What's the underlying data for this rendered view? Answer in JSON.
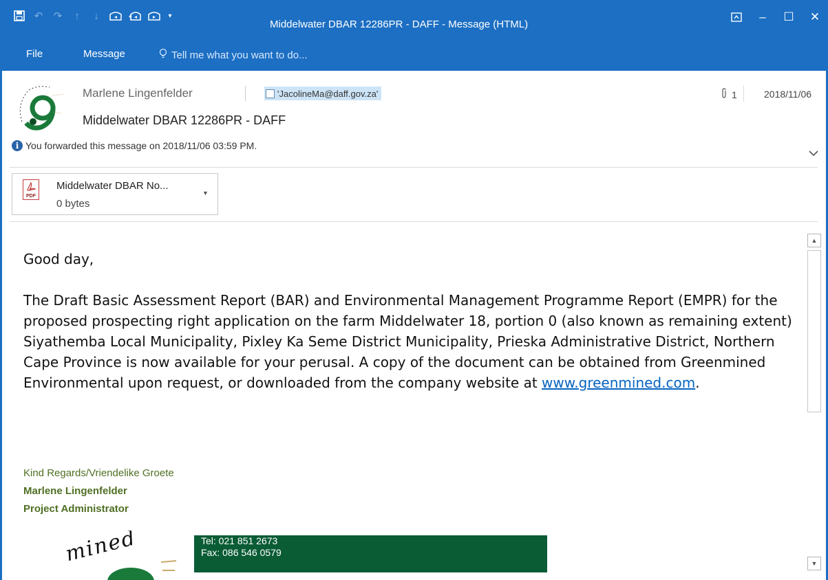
{
  "window": {
    "title": "Middelwater DBAR 12286PR - DAFF - Message (HTML)",
    "controls": [
      "ribbon-display-options",
      "minimize",
      "maximize",
      "close"
    ]
  },
  "quick_access": [
    "save-icon",
    "undo-icon",
    "redo-icon",
    "up-icon",
    "down-icon",
    "reply-icon",
    "reply-all-icon",
    "forward-icon",
    "customize-icon"
  ],
  "ribbon": {
    "tabs": [
      "File",
      "Message"
    ],
    "tell_me": "Tell me what you want to do..."
  },
  "header": {
    "sender": "Marlene Lingenfelder",
    "recipient": "'JacolineMa@daff.gov.za'",
    "attachment_count": "1",
    "date": "2018/11/06",
    "subject": "Middelwater DBAR 12286PR - DAFF",
    "info": "You forwarded this message on 2018/11/06 03:59 PM."
  },
  "attachment": {
    "name": "Middelwater DBAR No...",
    "size": "0 bytes",
    "type_label": "PDF"
  },
  "body": {
    "greeting": "Good day,",
    "paragraph": "The Draft Basic Assessment Report (BAR) and Environmental Management Programme Report (EMPR) for the proposed prospecting right application on the farm Middelwater 18, portion 0 (also known as remaining extent) Siyathemba Local Municipality, Pixley Ka Seme District Municipality, Prieska Administrative District, Northern Cape Province is now available for your perusal. A copy of the document can be obtained from Greenmined Environmental upon request, or downloaded from the company website at ",
    "link": "www.greenmined.com",
    "after_link": "."
  },
  "signature": {
    "regards": "Kind Regards/Vriendelike Groete",
    "name": "Marlene Lingenfelder",
    "role": "Project Administrator",
    "tel": "Tel: 021 851 2673",
    "fax": "Fax: 086 546 0579"
  },
  "colors": {
    "accent": "#1c6fc3",
    "signature_green": "#4f6f23",
    "contact_bar": "#0a5c35",
    "link": "#0563c1"
  }
}
